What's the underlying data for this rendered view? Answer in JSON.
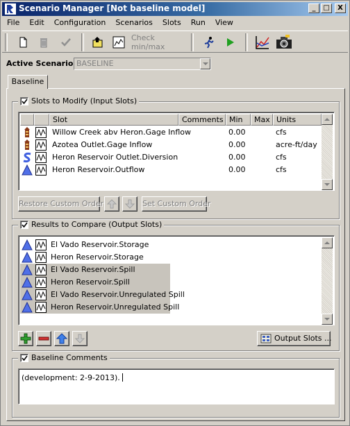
{
  "window": {
    "title": "Scenario Manager [Not baseline model]",
    "minimize": "_",
    "maximize": "□",
    "close": "X"
  },
  "menu": [
    "File",
    "Edit",
    "Configuration",
    "Scenarios",
    "Slots",
    "Run",
    "View"
  ],
  "toolbar": {
    "check_label": "Check min/max"
  },
  "active_scenario": {
    "label": "Active Scenario:",
    "value": "BASELINE"
  },
  "tabs": [
    {
      "label": "Baseline"
    }
  ],
  "input_slots": {
    "title": "Slots to Modify (Input Slots)",
    "checked": true,
    "columns": [
      "Slot",
      "Comments",
      "Min",
      "Max",
      "Units"
    ],
    "rows": [
      {
        "icon": "gage-icon",
        "slot": "Willow Creek abv Heron.Gage Inflow",
        "comments": "",
        "min": "0.00",
        "max": "",
        "units": "cfs"
      },
      {
        "icon": "gage-icon",
        "slot": "Azotea Outlet.Gage Inflow",
        "comments": "",
        "min": "0.00",
        "max": "",
        "units": "acre-ft/day"
      },
      {
        "icon": "diversion-icon",
        "slot": "Heron Reservoir Outlet.Diversion",
        "comments": "",
        "min": "0.00",
        "max": "",
        "units": "cfs"
      },
      {
        "icon": "reservoir-icon",
        "slot": "Heron Reservoir.Outflow",
        "comments": "",
        "min": "0.00",
        "max": "",
        "units": "cfs"
      }
    ],
    "restore_button": "Restore Custom Order",
    "set_button": "Set Custom Order"
  },
  "output_slots": {
    "title": "Results to Compare (Output Slots)",
    "checked": true,
    "rows": [
      {
        "slot": "El Vado Reservoir.Storage",
        "selected": false
      },
      {
        "slot": "Heron Reservoir.Storage",
        "selected": false
      },
      {
        "slot": "El Vado Reservoir.Spill",
        "selected": true
      },
      {
        "slot": "Heron Reservoir.Spill",
        "selected": true
      },
      {
        "slot": "El Vado Reservoir.Unregulated Spill",
        "selected": true
      },
      {
        "slot": "Heron Reservoir.Unregulated Spill",
        "selected": true
      }
    ],
    "output_button": "Output Slots ..."
  },
  "baseline_comments": {
    "title": "Baseline Comments",
    "checked": true,
    "text": "(development: 2-9-2013)."
  }
}
